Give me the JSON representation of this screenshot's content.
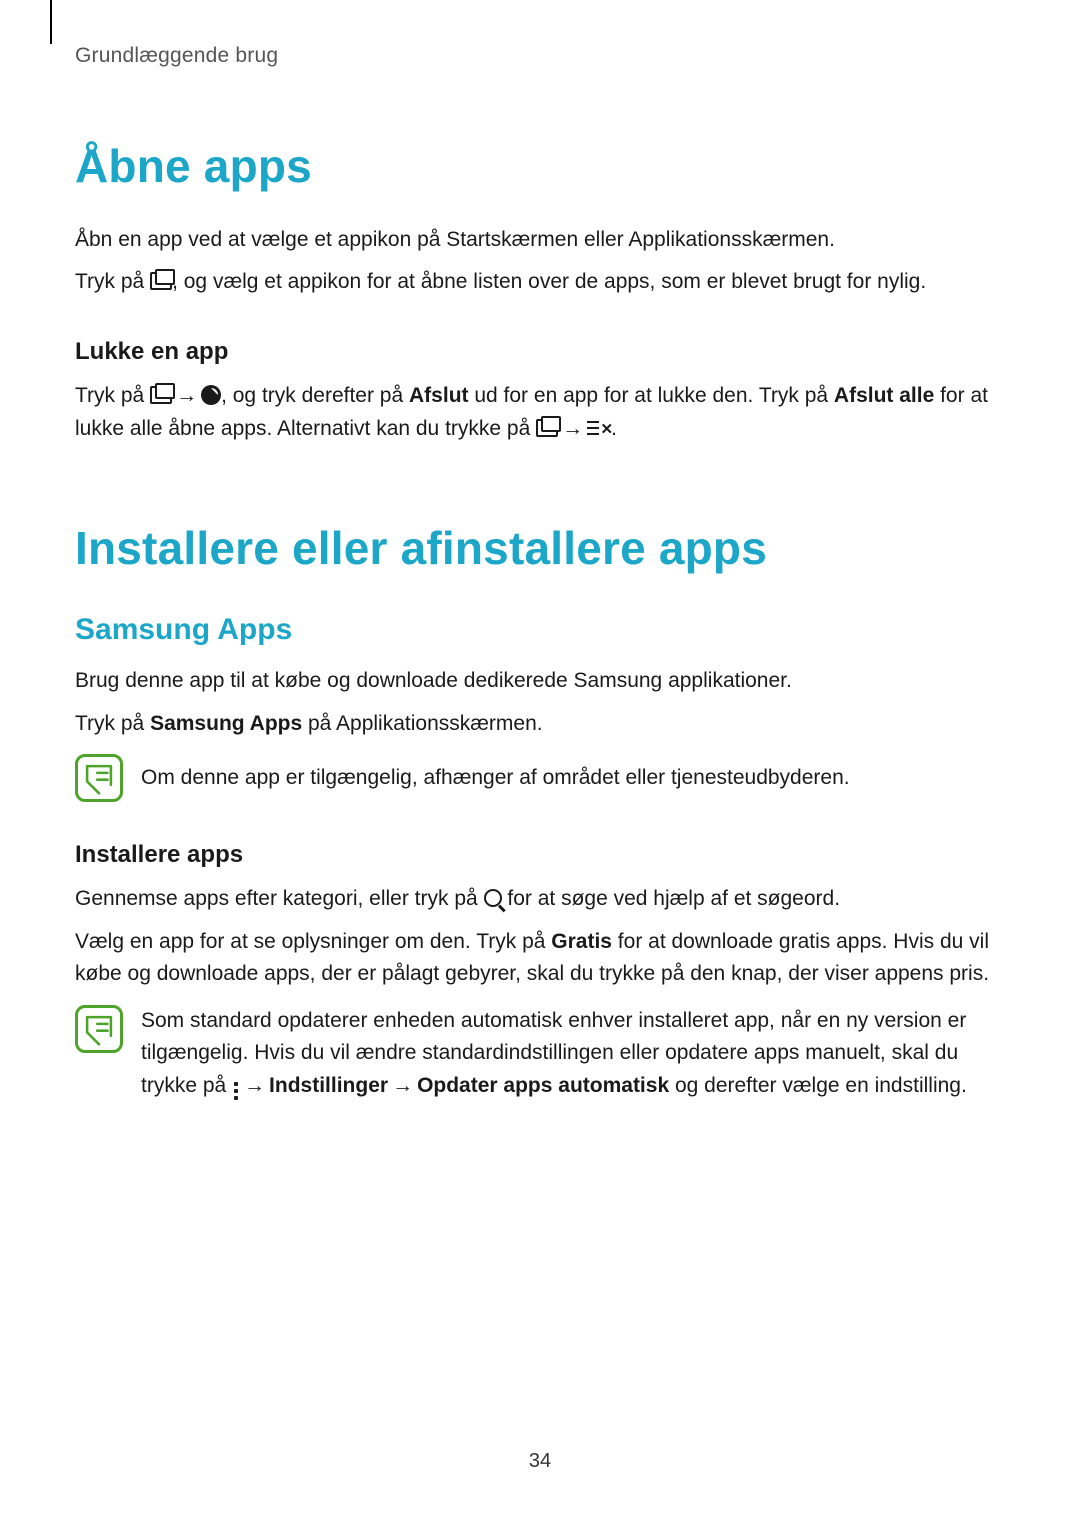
{
  "runningHead": "Grundlæggende brug",
  "section1": {
    "title": "Åbne apps",
    "p1": "Åbn en app ved at vælge et appikon på Startskærmen eller Applikationsskærmen.",
    "p2a": "Tryk på ",
    "p2b": ", og vælg et appikon for at åbne listen over de apps, som er blevet brugt for nylig.",
    "sub1": "Lukke en app",
    "p3a": "Tryk på ",
    "p3b": ", og tryk derefter på ",
    "p3_bold1": "Afslut",
    "p3c": " ud for en app for at lukke den. Tryk på ",
    "p3_bold2": "Afslut alle",
    "p3d": " for at lukke alle åbne apps. Alternativt kan du trykke på ",
    "p3e": "."
  },
  "section2": {
    "title": "Installere eller afinstallere apps",
    "subsection": "Samsung Apps",
    "p1": "Brug denne app til at købe og downloade dedikerede Samsung applikationer.",
    "p2a": "Tryk på ",
    "p2_bold": "Samsung Apps",
    "p2b": " på Applikationsskærmen.",
    "note1": "Om denne app er tilgængelig, afhænger af området eller tjenesteudbyderen.",
    "sub2": "Installere apps",
    "p3a": "Gennemse apps efter kategori, eller tryk på ",
    "p3b": " for at søge ved hjælp af et søgeord.",
    "p4a": "Vælg en app for at se oplysninger om den. Tryk på ",
    "p4_bold": "Gratis",
    "p4b": " for at downloade gratis apps. Hvis du vil købe og downloade apps, der er pålagt gebyrer, skal du trykke på den knap, der viser appens pris.",
    "note2a": "Som standard opdaterer enheden automatisk enhver installeret app, når en ny version er tilgængelig. Hvis du vil ændre standardindstillingen eller opdatere apps manuelt, skal du trykke på ",
    "note2_b1": "Indstillinger",
    "note2_b2": "Opdater apps automatisk",
    "note2b": " og derefter vælge en indstilling."
  },
  "arrow": "→",
  "pageNumber": "34"
}
